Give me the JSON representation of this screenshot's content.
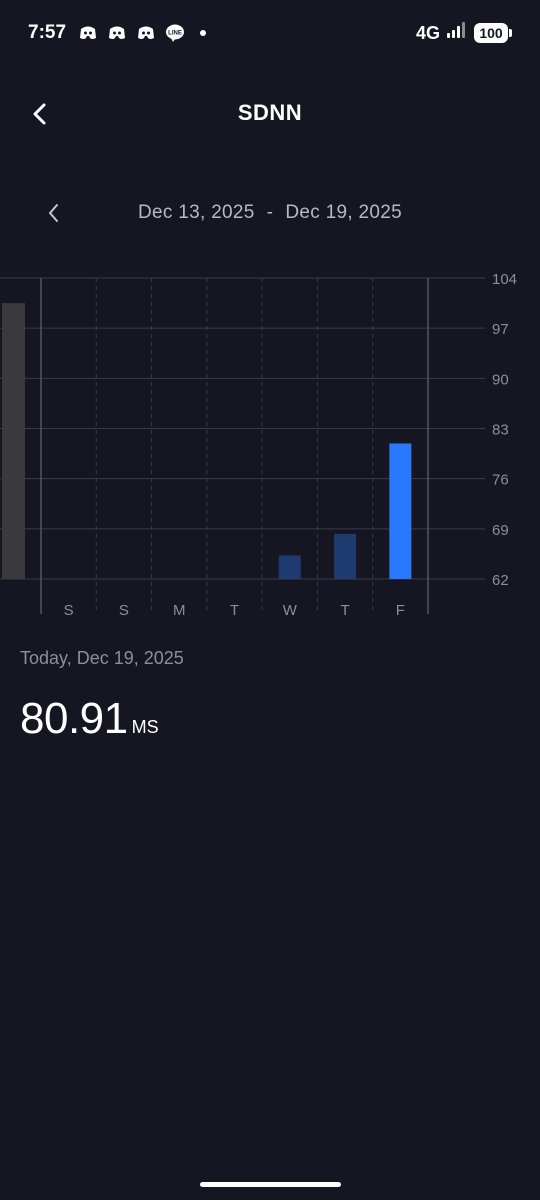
{
  "status_bar": {
    "time": "7:57",
    "notifications": [
      "discord-icon",
      "discord-icon",
      "discord-icon",
      "line-icon"
    ],
    "line_badge": "LINE",
    "network": "4G",
    "battery": "100"
  },
  "header": {
    "title": "SDNN"
  },
  "range": {
    "start": "Dec 13, 2025",
    "separator": "-",
    "end": "Dec 19, 2025"
  },
  "chart_data": {
    "type": "bar",
    "categories": [
      "S",
      "S",
      "M",
      "T",
      "W",
      "T",
      "F"
    ],
    "values": [
      null,
      null,
      null,
      null,
      65.3,
      68.3,
      80.91
    ],
    "previous_value": 100.5,
    "y_ticks": [
      "104",
      "97",
      "90",
      "83",
      "76",
      "69",
      "62"
    ],
    "ylim": [
      62,
      104
    ],
    "highlight_index": 6,
    "colors": {
      "highlight": "#2979ff",
      "normal": "#1d3b6e",
      "previous": "#3a3a3d",
      "grid": "#3a3a4a",
      "label": "#8e8e99"
    }
  },
  "summary": {
    "date_label": "Today, Dec 19, 2025",
    "value": "80.91",
    "unit": "MS"
  }
}
